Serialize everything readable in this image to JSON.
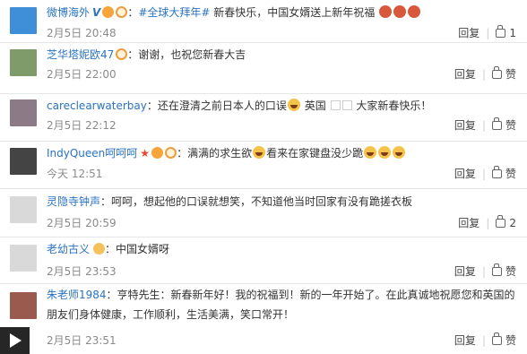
{
  "comments": [
    {
      "username": "微博海外",
      "topic": "#全球大拜年#",
      "text": "新春快乐，中国女婿送上新年祝福",
      "time": "2月5日 20:48",
      "reply": "回复",
      "like": "1",
      "avatar_color": "#3f8fd8"
    },
    {
      "username": "芝华塔妮欧47",
      "text": "：谢谢，也祝您新春大吉",
      "time": "2月5日 22:00",
      "reply": "回复",
      "like": "赞",
      "avatar_color": "#7f9b6a"
    },
    {
      "username": "careclearwaterbay",
      "text_a": "：还在澄清之前日本人的口误",
      "text_b": "英国",
      "text_c": "大家新春快乐！",
      "time": "2月5日 22:12",
      "reply": "回复",
      "like": "赞",
      "avatar_color": "#8c7b87"
    },
    {
      "username": "IndyQueen呵呵呵",
      "text_a": "：满满的求生欲",
      "text_b": "看来在家键盘没少跪",
      "time": "今天 12:51",
      "reply": "回复",
      "like": "赞",
      "avatar_color": "#444444"
    },
    {
      "username": "灵隐寺钟声",
      "text": "：呵呵，想起他的口误就想笑，不知道他当时回家有没有跪搓衣板",
      "time": "2月5日 20:59",
      "reply": "回复",
      "like": "2",
      "avatar_color": "#d9d9d9"
    },
    {
      "username": "老幼古义",
      "text": "：中国女婿呀",
      "time": "2月5日 23:53",
      "reply": "回复",
      "like": "赞",
      "avatar_color": "#d9d9d9"
    },
    {
      "username": "朱老师1984",
      "text": "：亨特先生：新春新年好！我的祝福到！新的一年开始了。在此真诚地祝愿您和英国的朋友们身体健康，工作顺利，生活美满，笑口常开！",
      "time": "2月5日 23:51",
      "reply": "回复",
      "like": "赞",
      "avatar_color": "#9b5a4e"
    }
  ]
}
